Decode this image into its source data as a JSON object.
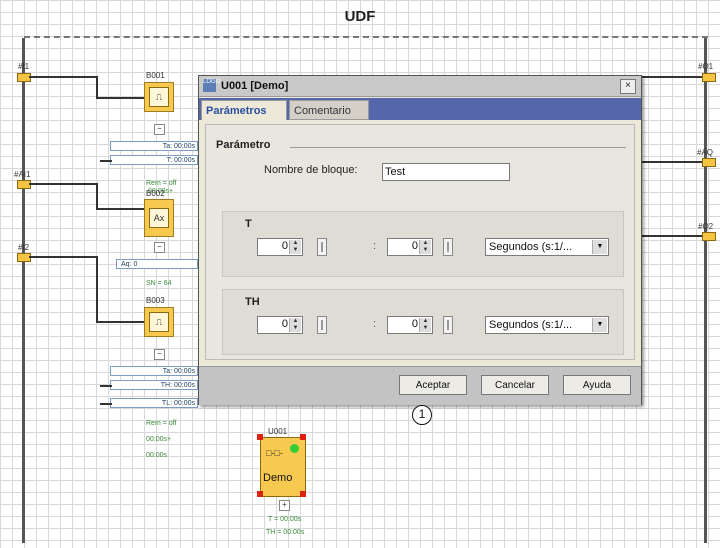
{
  "title": "UDF",
  "inputs": {
    "i1": "#I1",
    "ai1": "#AI1",
    "i2": "#I2"
  },
  "outputs": {
    "q1": "#Q1",
    "aq": "#AQ",
    "q2": "#Q2"
  },
  "blocks": {
    "b001": {
      "label": "B001",
      "ta": "Ta: 00:00s",
      "t": "T: 00:00s",
      "rem": "Rem = off",
      "time": "00:00s+"
    },
    "b002": {
      "label": "B002",
      "aq": "Aq: 0",
      "sn": "SN = 64"
    },
    "b003": {
      "label": "B003",
      "ta": "Ta: 00:00s",
      "th": "TH: 00:00s",
      "tl": "TL: 00:00s",
      "rem": "Rem = off",
      "time1": "00:00s+",
      "time2": "00:00s"
    },
    "u001": {
      "label": "U001",
      "name": "Demo",
      "t": "T = 00:00s",
      "th": "TH = 00:00s"
    }
  },
  "dialog": {
    "title": "U001 [Demo]",
    "close": "×",
    "tabs": [
      {
        "label": "Parámetros",
        "active": true
      },
      {
        "label": "Comentario",
        "active": false
      }
    ],
    "section_title": "Parámetro",
    "block_name_label": "Nombre de bloque:",
    "block_name_value": "Test",
    "group_t": {
      "title": "T",
      "value1": "0",
      "value2": "0",
      "separator": ":",
      "unit": "Segundos (s:1/..."
    },
    "group_th": {
      "title": "TH",
      "value1": "0",
      "value2": "0",
      "separator": ":",
      "unit": "Segundos (s:1/..."
    },
    "buttons": {
      "ok": "Aceptar",
      "cancel": "Cancelar",
      "help": "Ayuda"
    }
  },
  "callout": "1"
}
